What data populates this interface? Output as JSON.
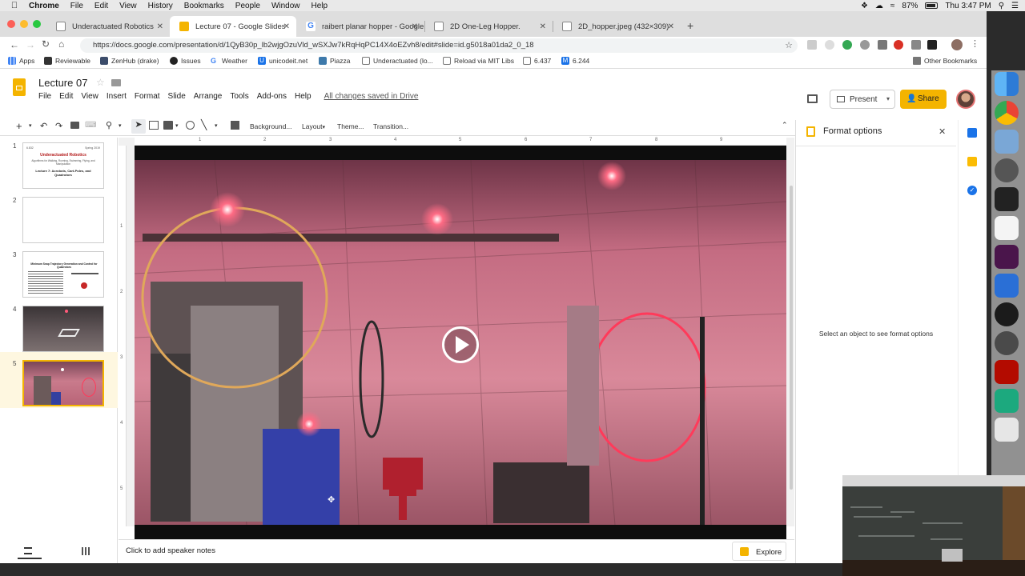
{
  "menubar": {
    "app_name": "Chrome",
    "items": [
      "File",
      "Edit",
      "View",
      "History",
      "Bookmarks",
      "People",
      "Window",
      "Help"
    ],
    "battery": "87%",
    "clock": "Thu 3:47 PM"
  },
  "tabs": [
    {
      "title": "Underactuated Robotics",
      "active": false,
      "favicon_color": "#8a8a8a"
    },
    {
      "title": "Lecture 07 - Google Slides",
      "active": true,
      "favicon_color": "#f4b400"
    },
    {
      "title": "raibert planar hopper - Google",
      "active": false,
      "favicon_color": "#4285f4"
    },
    {
      "title": "2D One-Leg Hopper.",
      "active": false,
      "favicon_color": "#8a8a8a"
    },
    {
      "title": "2D_hopper.jpeg (432×309)",
      "active": false,
      "favicon_color": "#8a8a8a"
    }
  ],
  "address": {
    "url": "https://docs.google.com/presentation/d/1QyB30p_lb2wjgOzuVld_wSXJw7kRqHqPC14X4oEZvh8/edit#slide=id.g5018a01da2_0_18"
  },
  "bookmarks": [
    {
      "label": "Apps",
      "icon": "apps-grid-icon"
    },
    {
      "label": "Reviewable",
      "icon": "reviewable-icon"
    },
    {
      "label": "ZenHub (drake)",
      "icon": "zenhub-icon"
    },
    {
      "label": "Issues",
      "icon": "github-icon"
    },
    {
      "label": "Weather",
      "icon": "google-icon"
    },
    {
      "label": "unicodeit.net",
      "icon": "u-icon"
    },
    {
      "label": "Piazza",
      "icon": "piazza-icon"
    },
    {
      "label": "Underactuated (lo...",
      "icon": "page-icon"
    },
    {
      "label": "Reload via MIT Libs",
      "icon": "page-icon"
    },
    {
      "label": "6.437",
      "icon": "page-icon"
    },
    {
      "label": "6.244",
      "icon": "m-icon"
    },
    {
      "label": "Other Bookmarks",
      "icon": "folder-icon"
    }
  ],
  "slides_app": {
    "doc_title": "Lecture 07",
    "menus": [
      "File",
      "Edit",
      "View",
      "Insert",
      "Format",
      "Slide",
      "Arrange",
      "Tools",
      "Add-ons",
      "Help"
    ],
    "saved_status": "All changes saved in Drive",
    "present_label": "Present",
    "share_label": "Share",
    "toolbar": {
      "background": "Background...",
      "layout": "Layout",
      "theme": "Theme...",
      "transition": "Transition..."
    },
    "ruler_ticks": [
      "1",
      "2",
      "3",
      "4",
      "5",
      "6",
      "7",
      "8",
      "9"
    ],
    "vertical_ruler_ticks": [
      "1",
      "2",
      "3",
      "4",
      "5"
    ],
    "slides": [
      {
        "number": "1",
        "header_left": "6.832",
        "header_right": "Spring 2019",
        "title": "Underactuated Robotics",
        "subtitle": "Algorithms for Walking, Running, Swimming, Flying, and Manipulation",
        "lecture": "Lecture 7: Acrobots, Cart-Poles, and Quadrotors"
      },
      {
        "number": "2"
      },
      {
        "number": "3",
        "title": "Minimum Snap Trajectory Generation and Control for Quadrotors"
      },
      {
        "number": "4"
      },
      {
        "number": "5",
        "selected": true
      }
    ],
    "speaker_notes_placeholder": "Click to add speaker notes",
    "explore_label": "Explore",
    "format_panel": {
      "title": "Format options",
      "empty_message": "Select an object to see format options"
    }
  },
  "colors": {
    "slides_yellow": "#f4b400",
    "tab_strip": "#dedede",
    "video_tint": "#c9788a"
  }
}
